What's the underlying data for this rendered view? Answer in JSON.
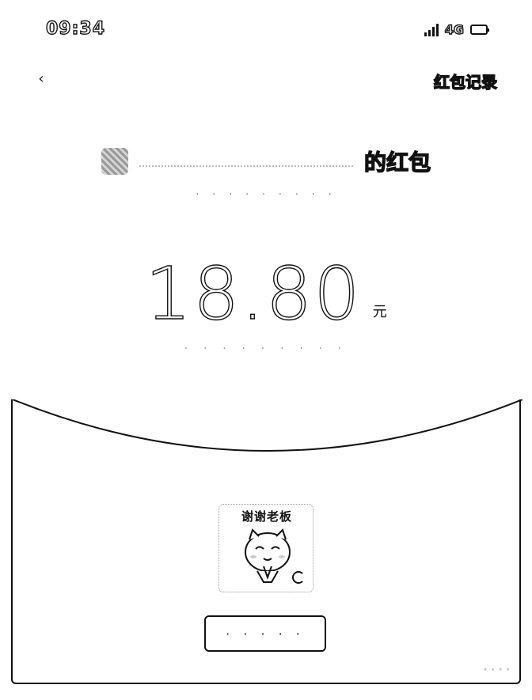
{
  "status_bar": {
    "time": "09:34",
    "network": "4G"
  },
  "nav": {
    "right_label": "红包记录"
  },
  "sender": {
    "title": "的红包"
  },
  "amount": {
    "value": "18.80",
    "unit": "元"
  },
  "sticker": {
    "caption": "谢谢老板"
  },
  "colors": {
    "text": "#111111",
    "background": "#ffffff",
    "muted": "#888888"
  }
}
